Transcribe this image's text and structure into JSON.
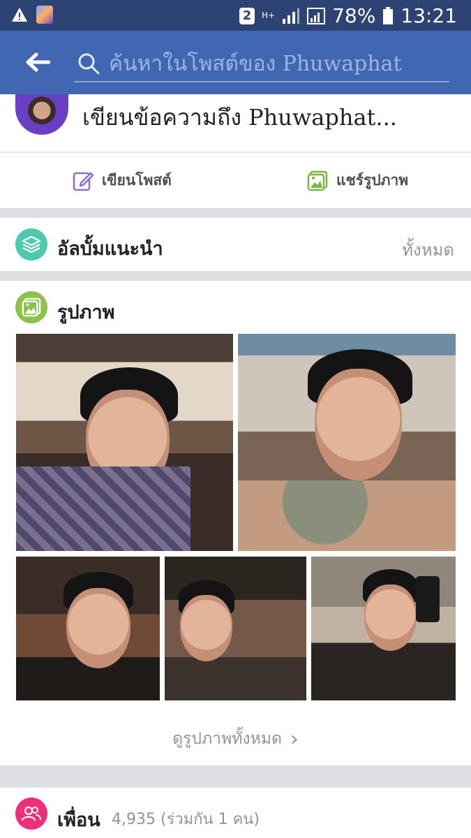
{
  "status_bar": {
    "sim_badge": "2",
    "network_type": "H+",
    "battery": "78%",
    "time": "13:21",
    "icons": [
      "warning-icon",
      "app-notification-icon",
      "signal-icon",
      "battery-icon"
    ]
  },
  "header": {
    "search_placeholder": "ค้นหาในโพสต์ของ Phuwaphat",
    "icons": [
      "back-arrow-icon",
      "search-icon"
    ],
    "color": "#4267b2"
  },
  "composer": {
    "prompt": "เขียนข้อความถึง Phuwaphat...",
    "write_post_label": "เขียนโพสต์",
    "share_photo_label": "แชร์รูปภาพ",
    "icons": [
      "edit-icon",
      "photo-icon"
    ]
  },
  "albums": {
    "title": "อัลบั้มแนะนำ",
    "see_all": "ทั้งหมด",
    "icon": "albums-stack-icon",
    "icon_color": "#4dc9b0"
  },
  "photos": {
    "title": "รูปภาพ",
    "view_all": "ดูรูปภาพทั้งหมด",
    "icon": "photo-icon",
    "icon_color": "#8bc34a"
  },
  "friends": {
    "title": "เพื่อน",
    "count": "4,935",
    "mutual": "(ร่วมกัน 1 คน)",
    "icon": "friends-icon",
    "icon_color": "#f02f7a"
  }
}
